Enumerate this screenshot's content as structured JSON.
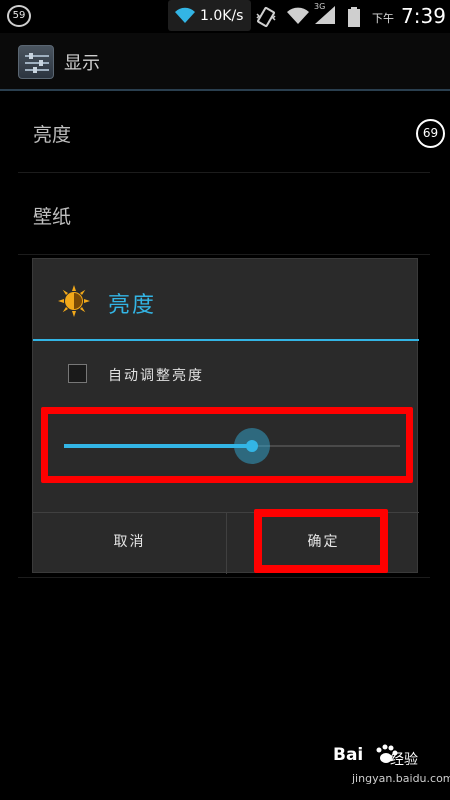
{
  "status_bar": {
    "notification_count": "59",
    "net_speed": "1.0K/s",
    "network_type": "3G",
    "ampm": "下午",
    "time": "7:39",
    "icons": [
      "wifi-icon",
      "vibrate-icon",
      "wifi-icon",
      "signal-icon",
      "battery-icon"
    ]
  },
  "action_bar": {
    "title": "显示",
    "icon": "display-settings-icon"
  },
  "settings_list": {
    "items": [
      {
        "label": "亮度"
      },
      {
        "label": "壁纸"
      }
    ],
    "side_badge": "69"
  },
  "dialog": {
    "title": "亮度",
    "icon": "brightness-sun-icon",
    "auto_brightness_label": "自动调整亮度",
    "auto_brightness_checked": false,
    "brightness_level": 0.56,
    "cancel_label": "取消",
    "ok_label": "确定"
  },
  "watermark": {
    "brand": "Bai",
    "brand_suffix": "经验",
    "url": "jingyan.baidu.com"
  },
  "colors": {
    "accent": "#33b5e5",
    "highlight": "#ff0000",
    "background": "#000000",
    "dialog_bg": "#2a2a2a"
  }
}
